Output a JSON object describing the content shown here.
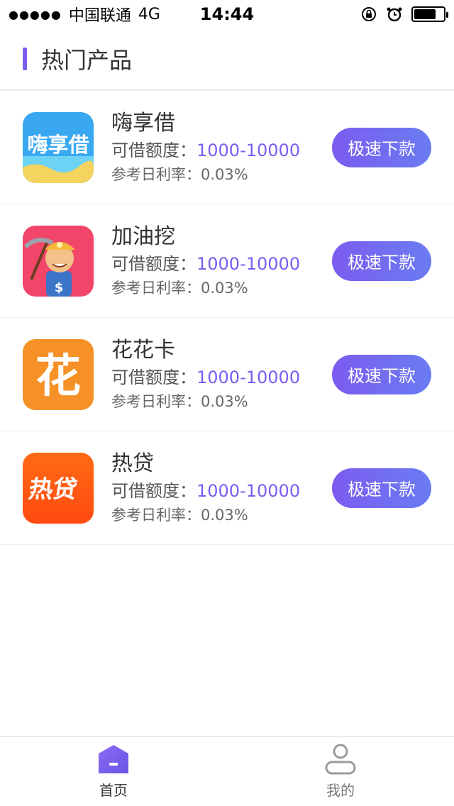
{
  "status": {
    "carrier": "中国联通",
    "network": "4G",
    "time": "14:44",
    "battery_level": 0.75
  },
  "header": {
    "title": "热门产品"
  },
  "products": [
    {
      "name": "嗨享借",
      "amount_label": "可借额度：",
      "amount_value": "1000-10000",
      "rate_label": "参考日利率：",
      "rate_value": "0.03%",
      "button": "极速下款",
      "logo_text": "嗨享借",
      "logo_color": "#3aa8f0"
    },
    {
      "name": "加油挖",
      "amount_label": "可借额度：",
      "amount_value": "1000-10000",
      "rate_label": "参考日利率：",
      "rate_value": "0.03%",
      "button": "极速下款",
      "logo_text": "",
      "logo_color": "#f2456a"
    },
    {
      "name": "花花卡",
      "amount_label": "可借额度：",
      "amount_value": "1000-10000",
      "rate_label": "参考日利率：",
      "rate_value": "0.03%",
      "button": "极速下款",
      "logo_text": "花",
      "logo_color": "#f69127"
    },
    {
      "name": "热贷",
      "amount_label": "可借额度：",
      "amount_value": "1000-10000",
      "rate_label": "参考日利率：",
      "rate_value": "0.03%",
      "button": "极速下款",
      "logo_text": "热贷",
      "logo_color": "#ff5a12"
    }
  ],
  "tabs": [
    {
      "label": "首页",
      "icon": "home-icon",
      "active": true
    },
    {
      "label": "我的",
      "icon": "user-icon",
      "active": false
    }
  ],
  "colors": {
    "accent": "#7b5cf0"
  }
}
